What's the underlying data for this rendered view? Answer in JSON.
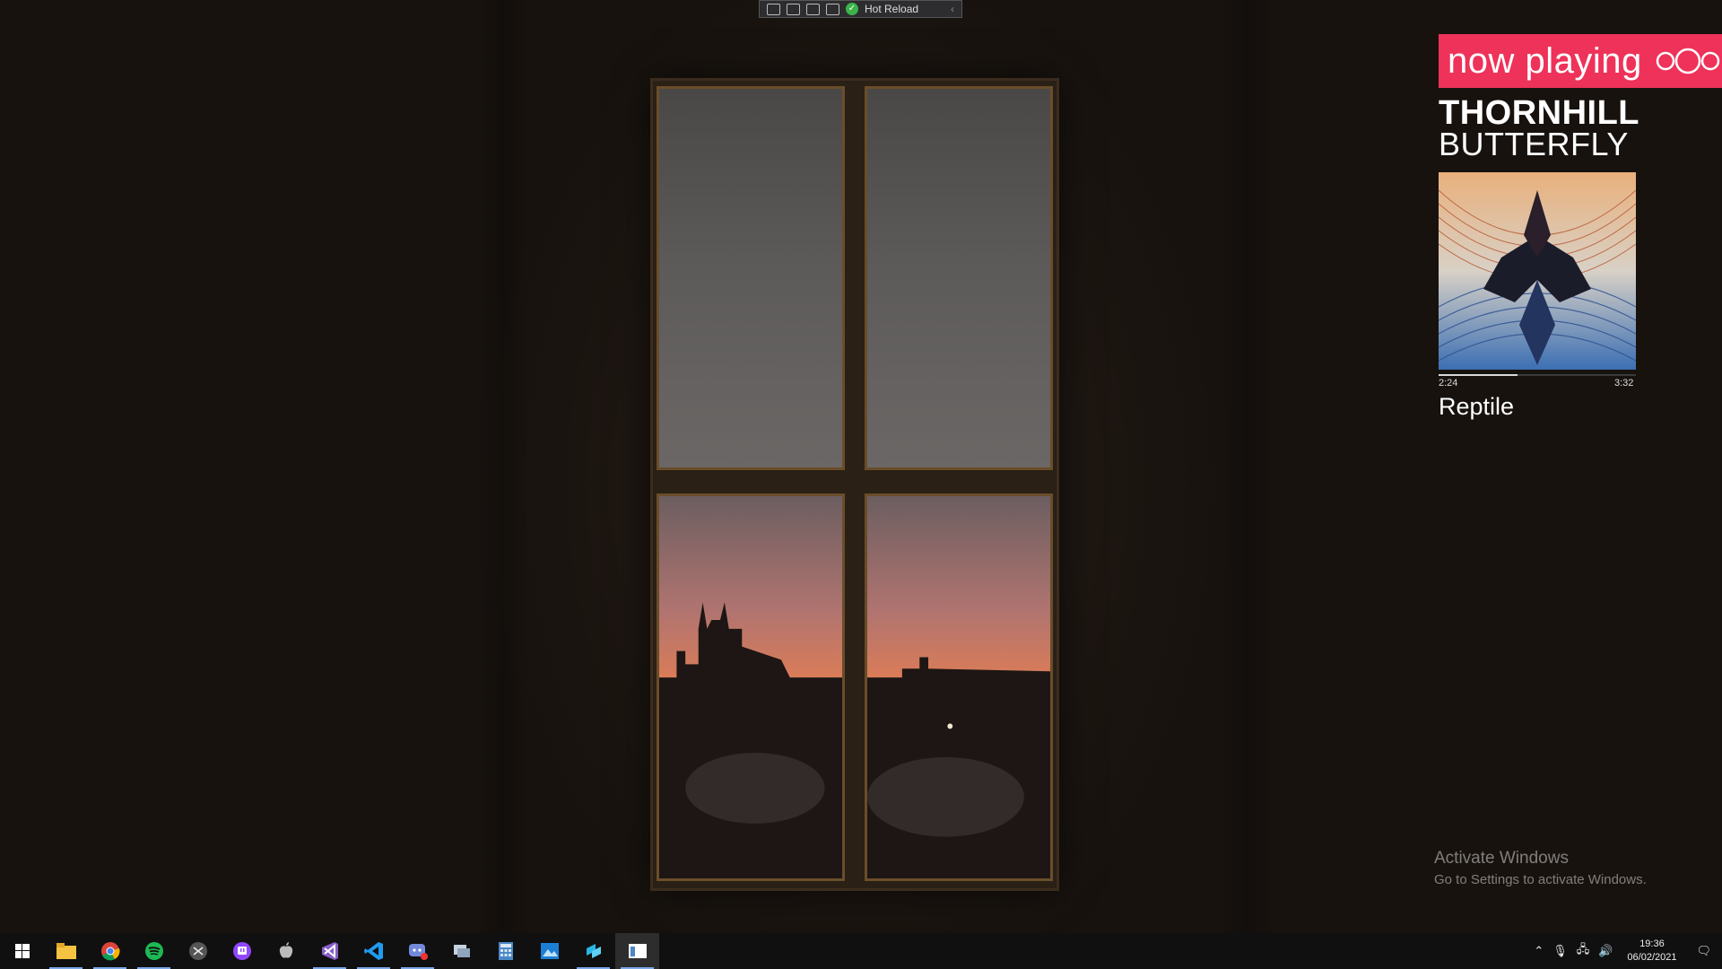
{
  "toolbar": {
    "hot_reload_label": "Hot Reload"
  },
  "now_playing": {
    "header_label": "now playing",
    "artist": "THORNHILL",
    "album": "BUTTERFLY",
    "elapsed": "2:24",
    "duration": "3:32",
    "progress_fraction": 0.4,
    "track": "Reptile",
    "accent_color": "#ee3259"
  },
  "watermark": {
    "title": "Activate Windows",
    "subtitle": "Go to Settings to activate Windows."
  },
  "taskbar": {
    "apps": [
      {
        "name": "start-button-icon"
      },
      {
        "name": "file-explorer-icon"
      },
      {
        "name": "chrome-icon"
      },
      {
        "name": "spotify-icon"
      },
      {
        "name": "app-icon"
      },
      {
        "name": "twitch-icon"
      },
      {
        "name": "apple-icon"
      },
      {
        "name": "visual-studio-icon"
      },
      {
        "name": "vscode-icon"
      },
      {
        "name": "discord-icon"
      },
      {
        "name": "scanner-icon"
      },
      {
        "name": "calculator-icon"
      },
      {
        "name": "photos-icon"
      },
      {
        "name": "blend-icon"
      },
      {
        "name": "app-window-icon"
      }
    ],
    "time": "19:36",
    "date": "06/02/2021"
  }
}
